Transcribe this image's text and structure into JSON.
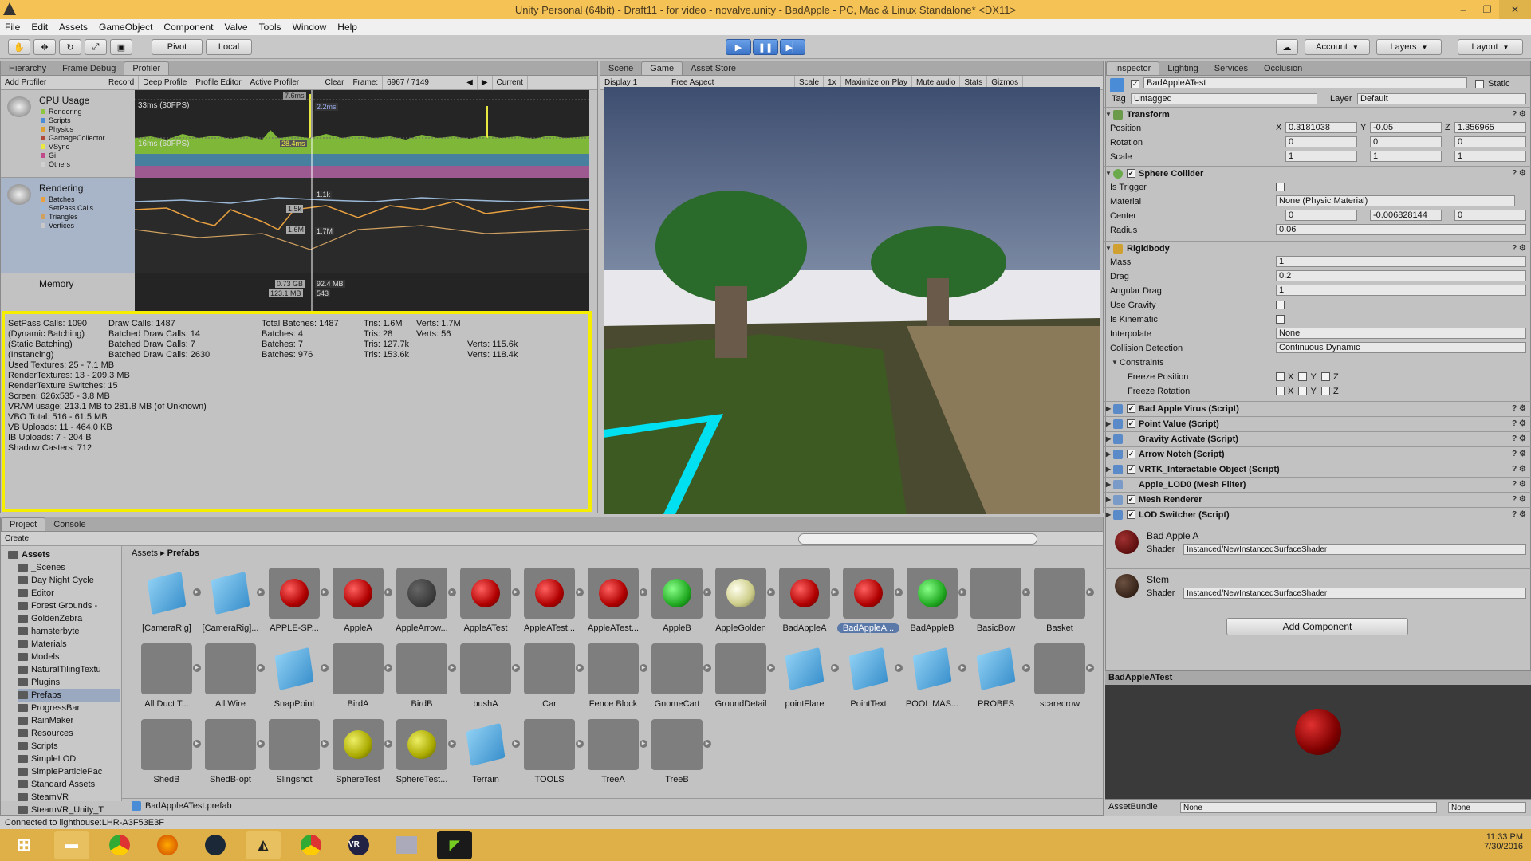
{
  "window": {
    "title": "Unity Personal (64bit) - Draft11 - for video - novalve.unity - BadApple - PC, Mac & Linux Standalone* <DX11>",
    "minimize": "–",
    "maximize": "❐",
    "close": "✕"
  },
  "menu": [
    "File",
    "Edit",
    "Assets",
    "GameObject",
    "Component",
    "Valve",
    "Tools",
    "Window",
    "Help"
  ],
  "toolbar": {
    "pivot": "Pivot",
    "local": "Local",
    "account": "Account",
    "layers": "Layers",
    "layout": "Layout",
    "tools": [
      "✋",
      "✥",
      "↻",
      "⤢",
      "▣"
    ],
    "play": "▶",
    "pause": "❚❚",
    "step": "▶▏"
  },
  "profiler": {
    "tabs": [
      "Hierarchy",
      "Frame Debug",
      "Profiler"
    ],
    "subbar": [
      "Add Profiler",
      "Record",
      "Deep Profile",
      "Profile Editor",
      "Active Profiler",
      "Clear",
      "Frame:",
      "6967 / 7149",
      "◀",
      "▶",
      "Current"
    ],
    "cpu": {
      "title": "CPU Usage",
      "legend": [
        {
          "name": "Rendering",
          "color": "#8ec63f"
        },
        {
          "name": "Scripts",
          "color": "#4a8cd6"
        },
        {
          "name": "Physics",
          "color": "#e0a030"
        },
        {
          "name": "GarbageCollector",
          "color": "#b04a3a"
        },
        {
          "name": "VSync",
          "color": "#e8e840"
        },
        {
          "name": "Gi",
          "color": "#c04a8a"
        },
        {
          "name": "Others",
          "color": "#d0d0d0"
        }
      ]
    },
    "rendering": {
      "title": "Rendering",
      "legend": [
        {
          "name": "Batches",
          "color": "#e8a040"
        },
        {
          "name": "SetPass Calls",
          "color": "#9ab8d8"
        },
        {
          "name": "Triangles",
          "color": "#d0a060"
        },
        {
          "name": "Vertices",
          "color": "#c8c8c8"
        }
      ]
    },
    "memory": {
      "title": "Memory"
    },
    "graph_labels": {
      "fps30": "33ms (30FPS)",
      "fps60": "16ms (60FPS)",
      "ms1": "7.6ms",
      "ms2": "2.2ms",
      "ms3": "28.4ms",
      "b1": "1.1k",
      "b2": "1.5k",
      "b3": "1.6M",
      "b4": "1.7M",
      "m1": "0.73 GB",
      "m2": "92.4 MB",
      "m3": "123.1 MB",
      "m4": "543"
    }
  },
  "stats": {
    "col1": [
      "SetPass Calls: 1090",
      "(Dynamic Batching)",
      "(Static Batching)",
      "(Instancing)",
      "Used Textures: 25 - 7.1 MB",
      "RenderTextures: 13 - 209.3 MB",
      "RenderTexture Switches: 15",
      "Screen: 626x535 - 3.8 MB",
      "VRAM usage: 213.1 MB to 281.8 MB (of Unknown)",
      "VBO Total: 516 - 61.5 MB",
      "VB Uploads: 11 - 464.0 KB",
      "IB Uploads: 7 - 204 B",
      "Shadow Casters: 712"
    ],
    "col2": [
      "Draw Calls: 1487",
      "Batched Draw Calls: 14",
      "Batched Draw Calls: 7",
      "Batched Draw Calls: 2630"
    ],
    "col3": [
      "Total Batches: 1487",
      "Batches: 4",
      "Batches: 7",
      "Batches: 976"
    ],
    "col4": [
      "Tris: 1.6M",
      "Tris: 28",
      "Tris: 127.7k",
      "Tris: 153.6k"
    ],
    "col5": [
      "Verts: 1.7M",
      "Verts: 56",
      "Verts: 115.6k",
      "Verts: 118.4k"
    ]
  },
  "game": {
    "tabs": [
      "Scene",
      "Game",
      "Asset Store"
    ],
    "subbar": [
      "Display 1",
      "Free Aspect",
      "Scale",
      "1x",
      "Maximize on Play",
      "Mute audio",
      "Stats",
      "Gizmos"
    ]
  },
  "inspector": {
    "tabs": [
      "Inspector",
      "Lighting",
      "Services",
      "Occlusion"
    ],
    "object": "BadAppleATest",
    "static": "Static",
    "tag_label": "Tag",
    "tag": "Untagged",
    "layer_label": "Layer",
    "layer": "Default",
    "transform": {
      "title": "Transform",
      "position_label": "Position",
      "rotation_label": "Rotation",
      "scale_label": "Scale",
      "pos": [
        "0.3181038",
        "-0.05",
        "1.356965"
      ],
      "rot": [
        "0",
        "0",
        "0"
      ],
      "scl": [
        "1",
        "1",
        "1"
      ]
    },
    "axes": [
      "X",
      "Y",
      "Z"
    ],
    "sphere": {
      "title": "Sphere Collider",
      "trigger": "Is Trigger",
      "material": "Material",
      "material_val": "None (Physic Material)",
      "center": "Center",
      "center_val": [
        "0",
        "-0.006828144",
        "0"
      ],
      "radius": "Radius",
      "radius_val": "0.06"
    },
    "rigidbody": {
      "title": "Rigidbody",
      "mass": "Mass",
      "mass_val": "1",
      "drag": "Drag",
      "drag_val": "0.2",
      "adrag": "Angular Drag",
      "adrag_val": "1",
      "gravity": "Use Gravity",
      "kinematic": "Is Kinematic",
      "interp": "Interpolate",
      "interp_val": "None",
      "coll": "Collision Detection",
      "coll_val": "Continuous Dynamic",
      "constraints": "Constraints",
      "fpos": "Freeze Position",
      "frot": "Freeze Rotation"
    },
    "scripts": [
      {
        "name": "Bad Apple Virus (Script)",
        "on": true
      },
      {
        "name": "Point Value (Script)",
        "on": true
      },
      {
        "name": "Gravity Activate (Script)",
        "on": false
      },
      {
        "name": "Arrow Notch (Script)",
        "on": true
      },
      {
        "name": "VRTK_Interactable Object (Script)",
        "on": true
      },
      {
        "name": "Apple_LOD0 (Mesh Filter)",
        "on": false
      },
      {
        "name": "Mesh Renderer",
        "on": true
      },
      {
        "name": "LOD Switcher (Script)",
        "on": true
      }
    ],
    "mat1": {
      "name": "Bad Apple A",
      "shader_label": "Shader",
      "shader": "Instanced/NewInstancedSurfaceShader"
    },
    "mat2": {
      "name": "Stem",
      "shader_label": "Shader",
      "shader": "Instanced/NewInstancedSurfaceShader"
    },
    "add_component": "Add Component",
    "preview_title": "BadAppleATest",
    "assetbundle_label": "AssetBundle",
    "assetbundle": "None",
    "assetbundle2": "None"
  },
  "project": {
    "tabs": [
      "Project",
      "Console"
    ],
    "create": "Create",
    "breadcrumb": [
      "Assets",
      "Prefabs"
    ],
    "tree": [
      "Assets",
      "_Scenes",
      "Day Night Cycle",
      "Editor",
      "Forest Grounds -",
      "GoldenZebra",
      "hamsterbyte",
      "Materials",
      "Models",
      "NaturalTilingTextu",
      "Plugins",
      "Prefabs",
      "ProgressBar",
      "RainMaker",
      "Resources",
      "Scripts",
      "SimpleLOD",
      "SimpleParticlePac",
      "Standard Assets",
      "SteamVR",
      "SteamVR_Unity_T"
    ],
    "assets_row1": [
      "[CameraRig]",
      "[CameraRig]...",
      "APPLE-SP...",
      "AppleA",
      "AppleArrow...",
      "AppleATest",
      "AppleATest...",
      "AppleATest...",
      "AppleB",
      "AppleGolden",
      "BadAppleA",
      "BadAppleA...",
      "BadAppleB",
      "BasicBow",
      "Basket"
    ],
    "assets_row2": [
      "All Duct T...",
      "All Wire",
      "SnapPoint",
      "BirdA",
      "BirdB",
      "bushA",
      "Car",
      "Fence Block",
      "GnomeCart",
      "GroundDetail",
      "pointFlare",
      "PointText",
      "POOL MAS...",
      "PROBES",
      "scarecrow"
    ],
    "assets_row3": [
      "ShedB",
      "ShedB-opt",
      "Slingshot",
      "SphereTest",
      "SphereTest...",
      "Terrain",
      "TOOLS",
      "TreeA",
      "TreeB"
    ],
    "footer": "BadAppleATest.prefab"
  },
  "status": "Connected to lighthouse:LHR-A3F53E3F",
  "taskbar": {
    "time": "11:33 PM",
    "date": "7/30/2016"
  }
}
